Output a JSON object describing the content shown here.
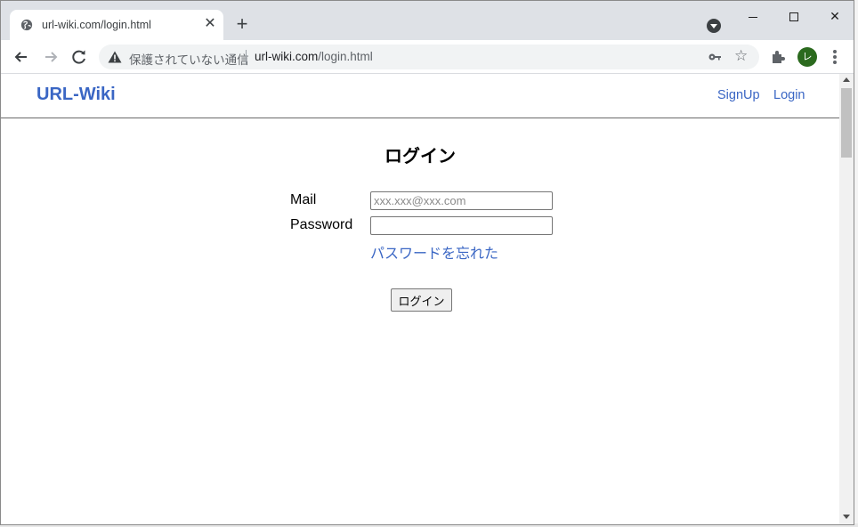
{
  "browser": {
    "tab_title": "url-wiki.com/login.html",
    "security_label": "保護されていない通信",
    "url_host": "url-wiki.com",
    "url_path": "/login.html",
    "profile_initial": "レ",
    "tab_close_glyph": "✕",
    "new_tab_glyph": "+",
    "star_glyph": "☆",
    "window_close_glyph": "✕"
  },
  "header": {
    "brand": "URL-Wiki",
    "nav": {
      "signup": "SignUp",
      "login": "Login"
    }
  },
  "login_form": {
    "title": "ログイン",
    "mail_label": "Mail",
    "mail_placeholder": "xxx.xxx@xxx.com",
    "mail_value": "",
    "password_label": "Password",
    "password_value": "",
    "forgot_link": "パスワードを忘れた",
    "submit_label": "ログイン"
  },
  "colors": {
    "link": "#3a66c4",
    "tab_strip": "#dee1e6",
    "profile_avatar": "#2b6a1e"
  },
  "icons": [
    "globe-icon",
    "close-icon",
    "plus-icon",
    "tab-search-icon",
    "back-arrow-icon",
    "forward-arrow-icon",
    "reload-icon",
    "warning-icon",
    "key-icon",
    "star-icon",
    "extensions-icon",
    "kebab-menu-icon"
  ]
}
